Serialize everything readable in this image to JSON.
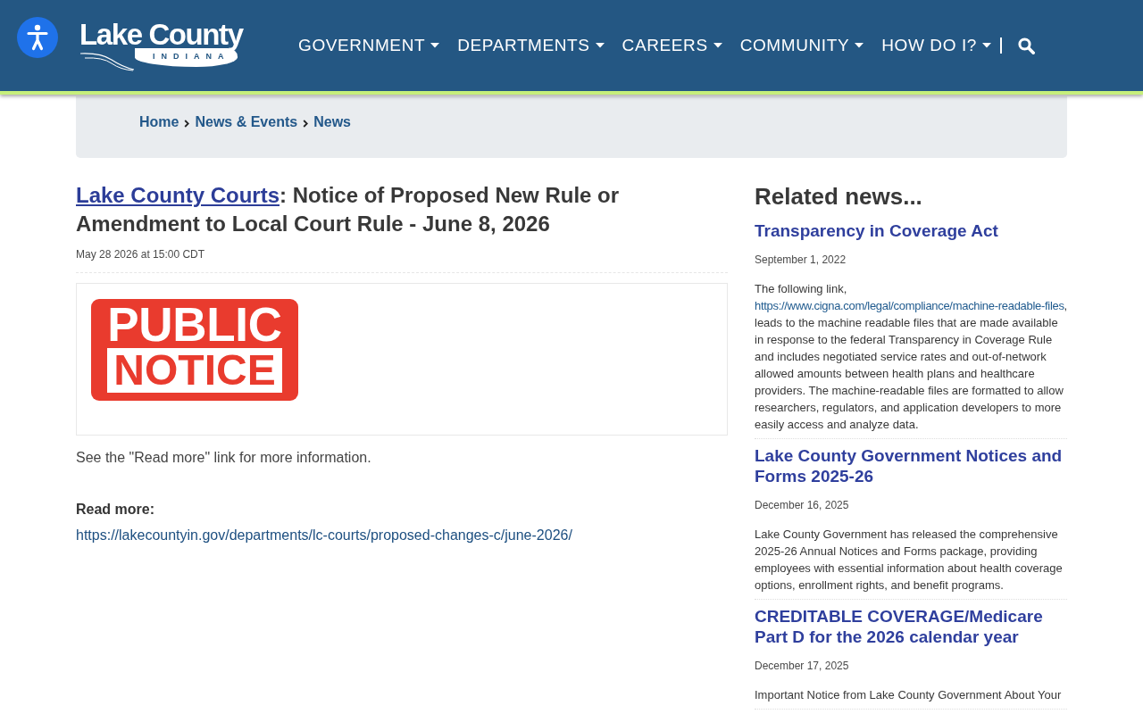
{
  "logo": {
    "wordmark": "Lake County",
    "subtitle": "INDIANA"
  },
  "nav": {
    "items": [
      {
        "label": "GOVERNMENT",
        "has_menu": true
      },
      {
        "label": "DEPARTMENTS",
        "has_menu": true
      },
      {
        "label": "CAREERS",
        "has_menu": true
      },
      {
        "label": "COMMUNITY",
        "has_menu": true
      },
      {
        "label": "HOW DO I?",
        "has_menu": true
      }
    ]
  },
  "breadcrumb": [
    {
      "label": "Home"
    },
    {
      "label": "News & Events"
    },
    {
      "label": "News"
    }
  ],
  "article": {
    "title_link": "Lake County Courts",
    "title_rest": ": Notice of Proposed New Rule or Amendment to Local Court Rule - June 8, 2026",
    "date": "May 28 2026 at 15:00 CDT",
    "image": {
      "line_1": "PUBLIC",
      "line_2": "NOTICE"
    },
    "summary": "See the \"Read more\" link for more information.",
    "read_more_label": "Read more:",
    "read_more_url": "https://lakecountyin.gov/departments/lc-courts/proposed-changes-c/june-2026/"
  },
  "related": {
    "heading": "Related news...",
    "items": [
      {
        "title": "Transparency in Coverage Act",
        "date": "September 1, 2022",
        "body": [
          {
            "kind": "text",
            "text": "The following link, "
          },
          {
            "kind": "link",
            "text": "https://www.cigna.com/legal/compliance/machine-readable-files"
          },
          {
            "kind": "text",
            "text": ", leads to the machine readable files that are made available in response to the federal Transparency in Coverage Rule and includes negotiated service rates and out-of-network allowed amounts between health plans and healthcare providers. The machine-readable files are formatted to allow researchers, regulators, and application developers to more easily access and analyze data."
          }
        ]
      },
      {
        "title": "Lake County Government Notices and Forms 2025-26",
        "date": "December 16, 2025",
        "body": [
          {
            "kind": "text",
            "text": "Lake County Government has released the comprehensive 2025-26 Annual Notices and Forms package, providing employees with essential information about health coverage options, enrollment rights, and benefit programs."
          }
        ]
      },
      {
        "title": "CREDITABLE COVERAGE/Medicare Part D for the 2026 calendar year",
        "date": "December 17, 2025",
        "body": [
          {
            "kind": "text",
            "text": "Important Notice from Lake County Government About Your"
          }
        ]
      }
    ]
  }
}
